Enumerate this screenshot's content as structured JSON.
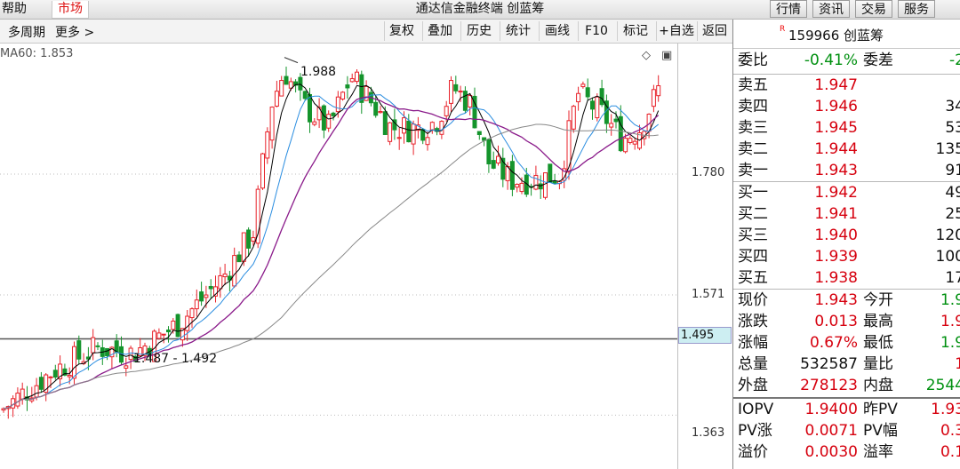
{
  "menubar": {
    "help": "帮助",
    "market": "市场",
    "title": "通达信金融终端 创蓝筹",
    "right_buttons": [
      "行情",
      "资讯",
      "交易",
      "服务"
    ]
  },
  "toolbar": {
    "period": "多周期",
    "more": "更多 >",
    "buttons": [
      "复权",
      "叠加",
      "历史",
      "统计",
      "画线",
      "F10",
      "标记",
      "+自选",
      "返回"
    ]
  },
  "chart": {
    "ma_label": "MA60: 1.853",
    "high_label": "1.988",
    "range_label": "1.487 - 1.492",
    "price_axis": [
      "1.780",
      "1.571",
      "1.363"
    ],
    "current_price_box": "1.495",
    "icons": [
      "diamond-icon",
      "window-icon"
    ]
  },
  "chart_data": {
    "type": "candlestick",
    "ma_label": "MA60: 1.853",
    "y_ticks": [
      1.78,
      1.571,
      1.363
    ],
    "marked_high": 1.988,
    "marked_range": "1.487 - 1.492",
    "horizontal_line": 1.495
  },
  "quote": {
    "r_mark": "R",
    "code": "159966 创蓝筹",
    "webi_label": "委比",
    "webi_value": "-0.41%",
    "weicha_label": "委差",
    "weicha_value": "-2",
    "sell": [
      {
        "label": "卖五",
        "price": "1.947",
        "qty": ""
      },
      {
        "label": "卖四",
        "price": "1.946",
        "qty": "34"
      },
      {
        "label": "卖三",
        "price": "1.945",
        "qty": "53"
      },
      {
        "label": "卖二",
        "price": "1.944",
        "qty": "135"
      },
      {
        "label": "卖一",
        "price": "1.943",
        "qty": "91"
      }
    ],
    "buy": [
      {
        "label": "买一",
        "price": "1.942",
        "qty": "49"
      },
      {
        "label": "买二",
        "price": "1.941",
        "qty": "25"
      },
      {
        "label": "买三",
        "price": "1.940",
        "qty": "120"
      },
      {
        "label": "买四",
        "price": "1.939",
        "qty": "100"
      },
      {
        "label": "买五",
        "price": "1.938",
        "qty": "17"
      }
    ],
    "stats": [
      {
        "k": "现价",
        "v": "1.943",
        "vc": "red",
        "k2": "今开",
        "v2": "1.9",
        "v2c": "green"
      },
      {
        "k": "涨跌",
        "v": "0.013",
        "vc": "red",
        "k2": "最高",
        "v2": "1.9",
        "v2c": "red"
      },
      {
        "k": "涨幅",
        "v": "0.67%",
        "vc": "red",
        "k2": "最低",
        "v2": "1.9",
        "v2c": "green"
      },
      {
        "k": "总量",
        "v": "532587",
        "vc": "",
        "k2": "量比",
        "v2": "1",
        "v2c": "red"
      },
      {
        "k": "外盘",
        "v": "278123",
        "vc": "red",
        "k2": "内盘",
        "v2": "2544",
        "v2c": "green"
      }
    ],
    "iopv": [
      {
        "k": "IOPV",
        "v": "1.9400",
        "k2": "昨PV",
        "v2": "1.93"
      },
      {
        "k": "PV涨",
        "v": "0.0071",
        "k2": "PV幅",
        "v2": "0.3"
      },
      {
        "k": "溢价",
        "v": "0.0030",
        "k2": "溢率",
        "v2": "0.1"
      }
    ]
  },
  "colors": {
    "up": "#e8222a",
    "down": "#14942c",
    "ma5": "#000000",
    "ma10": "#2a8de0",
    "ma20": "#8a1a8a",
    "ma60": "#888888"
  }
}
